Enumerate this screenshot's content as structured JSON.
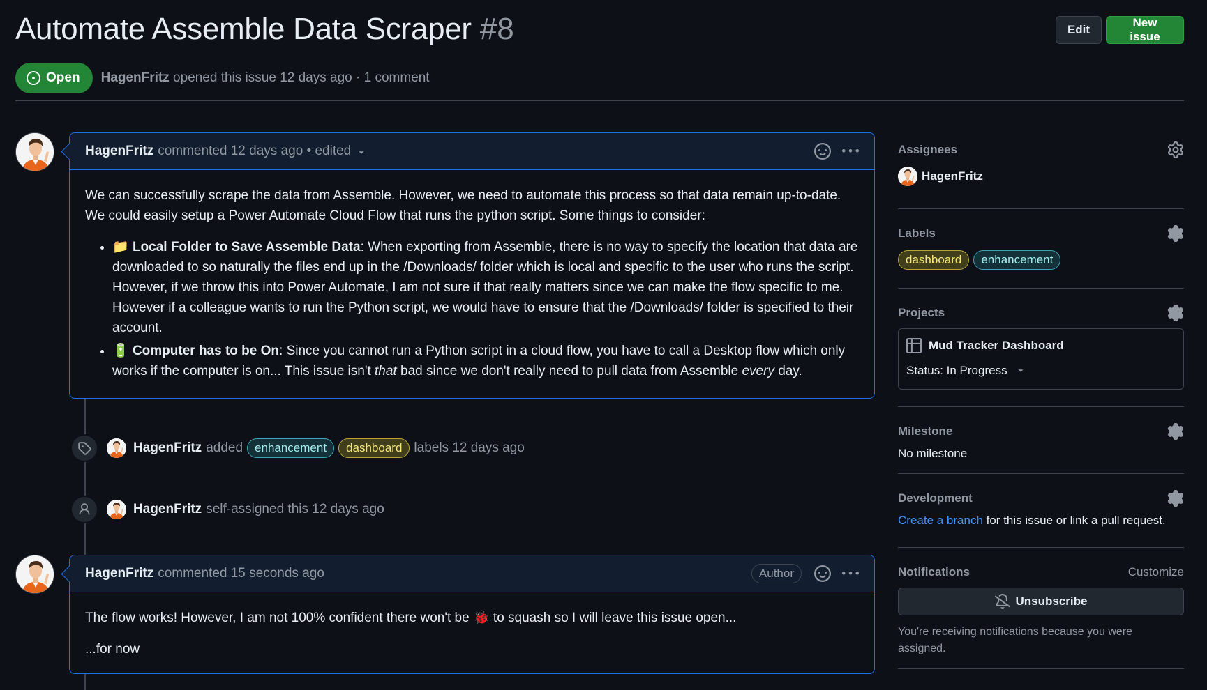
{
  "issue": {
    "title": "Automate Assemble Data Scraper",
    "number": "#8",
    "state": "Open",
    "author": "HagenFritz",
    "opened_text": "opened this issue 12 days ago · 1 comment"
  },
  "header_actions": {
    "edit": "Edit",
    "new_issue": "New issue"
  },
  "comments": [
    {
      "author": "HagenFritz",
      "info": "commented 12 days ago • edited",
      "body": {
        "intro": "We can successfully scrape the data from Assemble. However, we need to automate this process so that data remain up-to-date. We could easily setup a Power Automate Cloud Flow that runs the python script. Some things to consider:",
        "items": [
          {
            "icon": "📁",
            "title": "Local Folder to Save Assemble Data",
            "text": ": When exporting from Assemble, there is no way to specify the location that data are downloaded to so naturally the files end up in the /Downloads/ folder which is local and specific to the user who runs the script. However, if we throw this into Power Automate, I am not sure if that really matters since we can make the flow specific to me. However if a colleague wants to run the Python script, we would have to ensure that the /Downloads/ folder is specified to their account."
          },
          {
            "icon": "🔋",
            "title": "Computer has to be On",
            "text_a": ": Since you cannot run a Python script in a cloud flow, you have to call a Desktop flow which only works if the computer is on... This issue isn't ",
            "em_a": "that",
            "text_b": " bad since we don't really need to pull data from Assemble ",
            "em_b": "every",
            "text_c": " day."
          }
        ]
      }
    },
    {
      "author": "HagenFritz",
      "info": "commented 15 seconds ago",
      "badge": "Author",
      "body": {
        "p1_a": "The flow works! However, I am not 100% confident there won't be ",
        "p1_emoji": "🐞",
        "p1_b": " to squash so I will leave this issue open...",
        "p2": "...for now"
      }
    }
  ],
  "events": [
    {
      "actor": "HagenFritz",
      "verb": "added",
      "labels": [
        "enhancement",
        "dashboard"
      ],
      "suffix": "labels 12 days ago"
    },
    {
      "actor": "HagenFritz",
      "text": "self-assigned this 12 days ago"
    }
  ],
  "sidebar": {
    "assignees": {
      "heading": "Assignees",
      "name": "HagenFritz"
    },
    "labels": {
      "heading": "Labels",
      "items": [
        "dashboard",
        "enhancement"
      ]
    },
    "projects": {
      "heading": "Projects",
      "name": "Mud Tracker Dashboard",
      "status": "Status: In Progress"
    },
    "milestone": {
      "heading": "Milestone",
      "value": "No milestone"
    },
    "development": {
      "heading": "Development",
      "link": "Create a branch",
      "text": " for this issue or link a pull request."
    },
    "notifications": {
      "heading": "Notifications",
      "customize": "Customize",
      "button": "Unsubscribe",
      "note": "You're receiving notifications because you were assigned."
    }
  },
  "colors": {
    "background": "#0d1117",
    "accent_green": "#238636",
    "comment_border": "#1f6feb",
    "link": "#4493f8"
  }
}
